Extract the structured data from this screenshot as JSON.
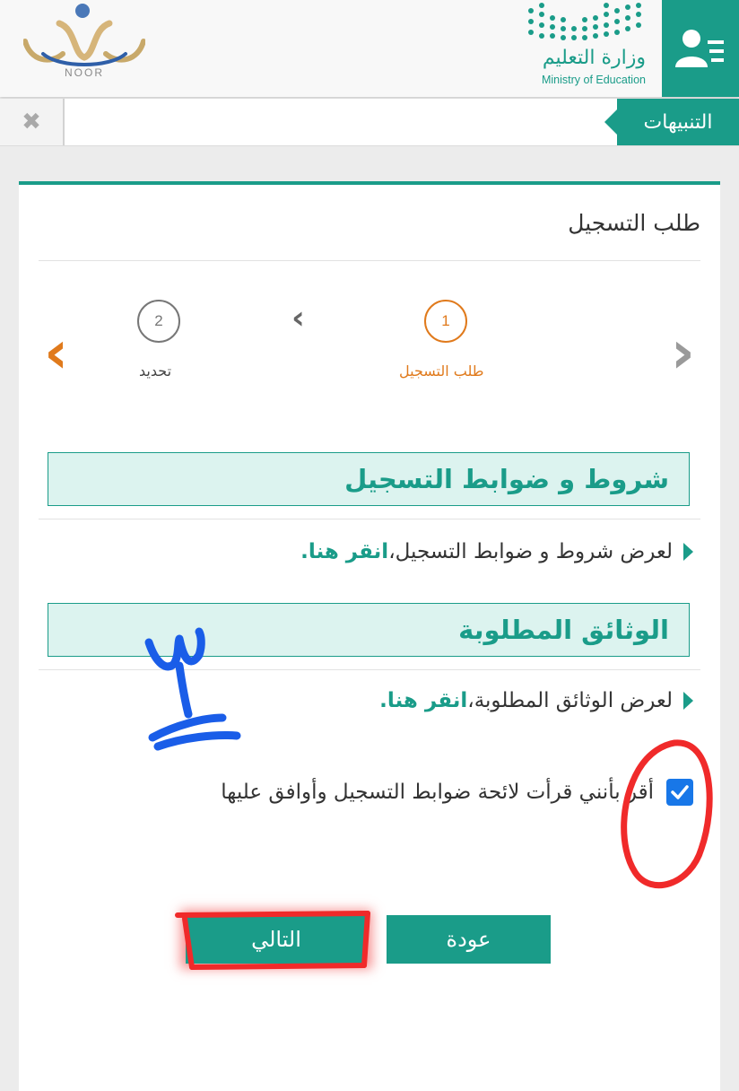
{
  "header": {
    "logo_text": "NOOR",
    "ministry_ar": "وزارة التعليم",
    "ministry_en": "Ministry of Education",
    "user_icon": "user-menu-icon"
  },
  "notifications": {
    "label": "التنبيهات",
    "close_glyph": "✖"
  },
  "page": {
    "title": "طلب التسجيل"
  },
  "wizard": {
    "steps": [
      {
        "number": "1",
        "label": "طلب التسجيل",
        "state": "active"
      },
      {
        "number": "2",
        "label": "تحديد",
        "state": "pending"
      }
    ],
    "prev_icon": "chevron-right-icon",
    "next_icon": "chevron-left-icon"
  },
  "sections": [
    {
      "heading": "شروط و ضوابط التسجيل",
      "text": "لعرض شروط و ضوابط التسجيل،",
      "link": "انقر هنا."
    },
    {
      "heading": "الوثائق المطلوبة",
      "text": "لعرض الوثائق المطلوبة،",
      "link": "انقر هنا."
    }
  ],
  "agreement": {
    "text": "أقر بأنني قرأت لائحة ضوابط التسجيل وأوافق عليها",
    "checked": true
  },
  "buttons": {
    "next": "التالي",
    "back": "عودة"
  },
  "annotation": {
    "handwritten_number": "٣"
  },
  "colors": {
    "primary": "#1a9c89",
    "accent": "#e07a1c",
    "checkbox": "#1877e8",
    "annotation_blue": "#1a5de8",
    "annotation_red": "#f02a2a"
  }
}
